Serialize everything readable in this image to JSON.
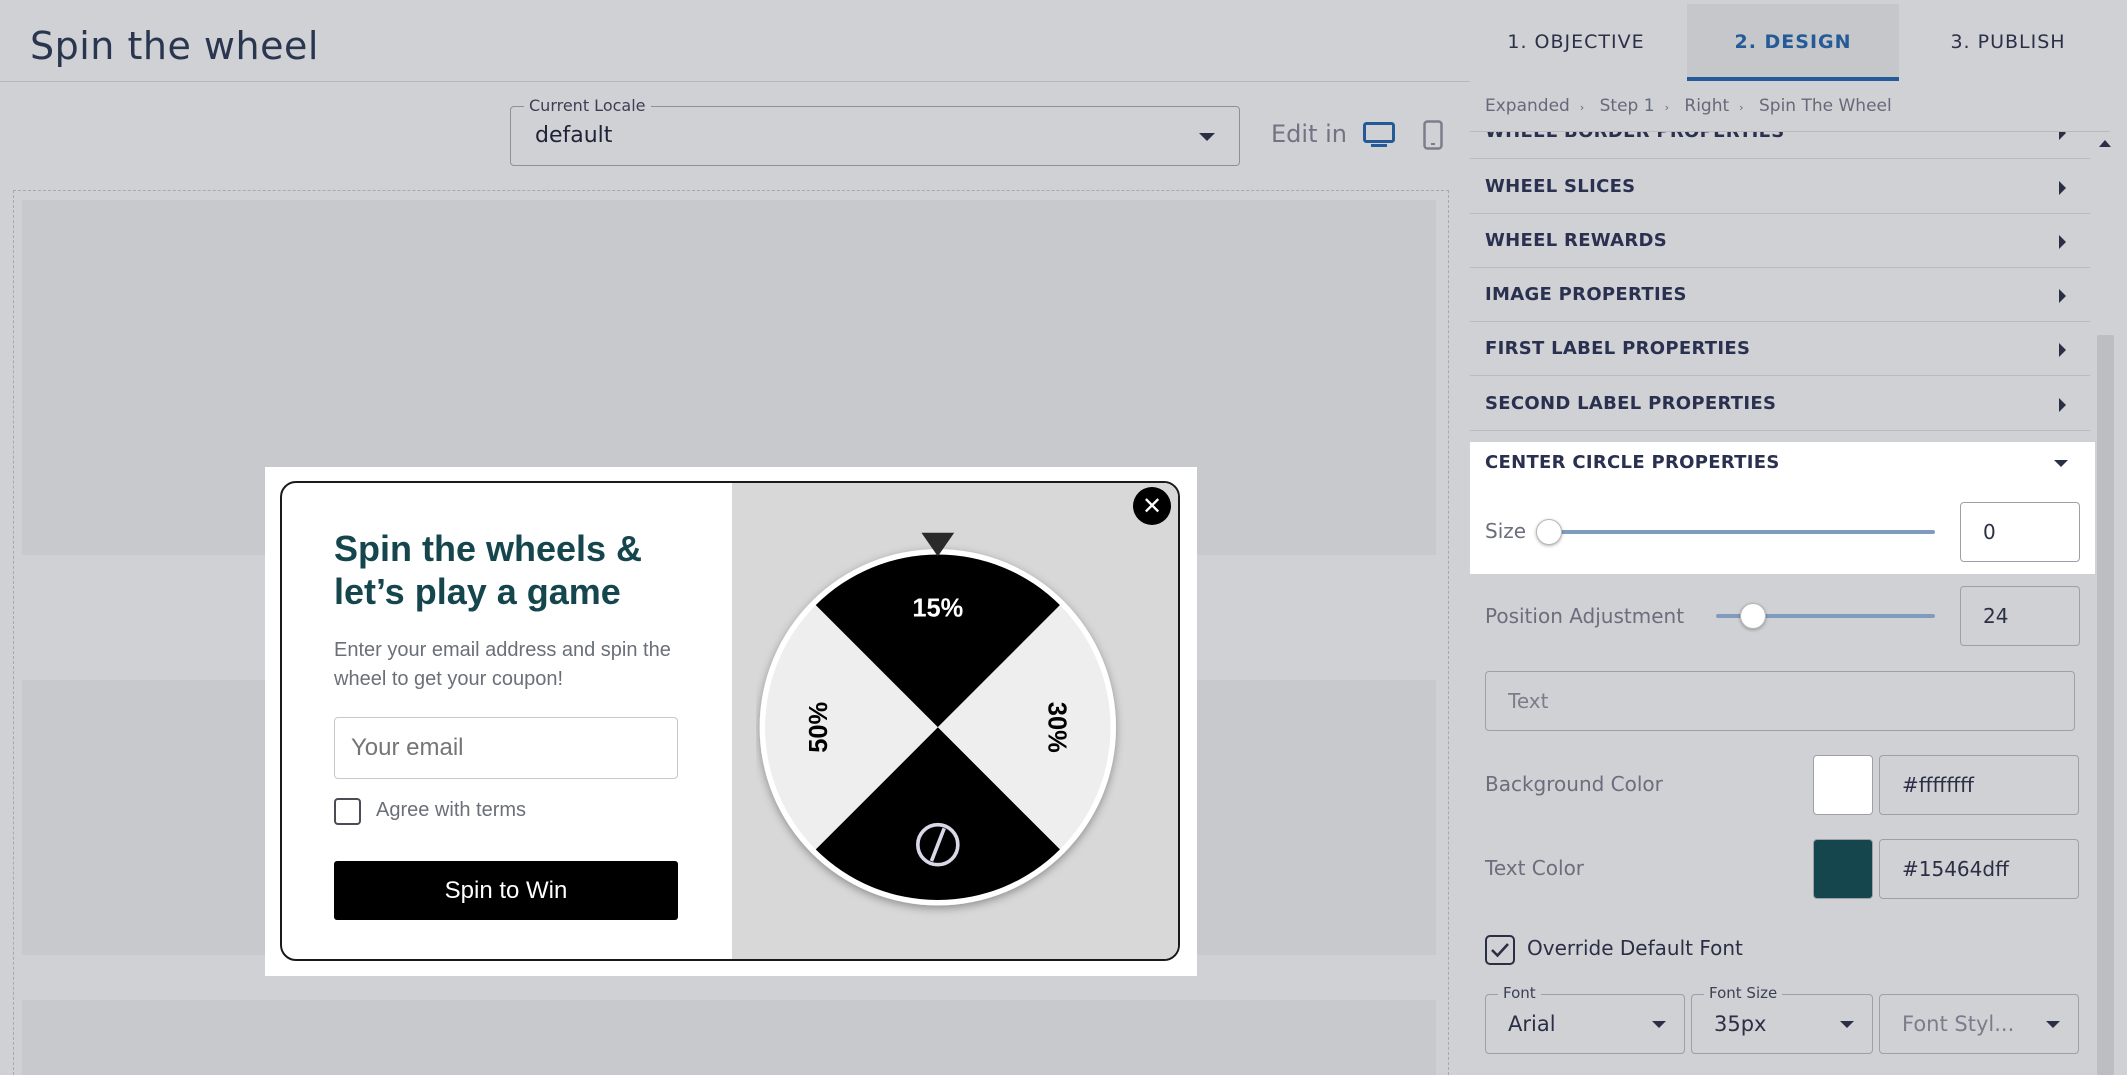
{
  "header": {
    "title": "Spin the wheel"
  },
  "locale": {
    "legend": "Current Locale",
    "value": "default"
  },
  "edit_in": {
    "label": "Edit in",
    "desktop_icon": "desktop-monitor-icon",
    "mobile_icon": "mobile-phone-icon"
  },
  "popup": {
    "headline": "Spin the wheels & let’s play a game",
    "description": "Enter your email address and spin the wheel to get your coupon!",
    "email_placeholder": "Your email",
    "terms_label": "Agree with terms",
    "button_label": "Spin to Win",
    "close_symbol": "✕",
    "headline_color": "#15464d",
    "wheel": {
      "slices": [
        {
          "label": "15%",
          "color": "#000000",
          "text_color": "#ffffff"
        },
        {
          "label": "30%",
          "color": "#eeeeee",
          "text_color": "#000000"
        },
        {
          "label": "",
          "color": "#000000",
          "text_color": "#ffffff",
          "icon": "no-symbol-icon"
        },
        {
          "label": "50%",
          "color": "#eeeeee",
          "text_color": "#000000"
        }
      ]
    }
  },
  "tabs": [
    {
      "label": "1. OBJECTIVE"
    },
    {
      "label": "2. DESIGN",
      "active": true
    },
    {
      "label": "3. PUBLISH"
    }
  ],
  "breadcrumb": [
    "Expanded",
    "Step 1",
    "Right",
    "Spin The Wheel"
  ],
  "sections": [
    {
      "label": "WHEEL BORDER PROPERTIES"
    },
    {
      "label": "WHEEL SLICES"
    },
    {
      "label": "WHEEL REWARDS"
    },
    {
      "label": "IMAGE PROPERTIES"
    },
    {
      "label": "FIRST LABEL PROPERTIES"
    },
    {
      "label": "SECOND LABEL PROPERTIES"
    }
  ],
  "center_circle": {
    "label": "CENTER CIRCLE PROPERTIES",
    "size_label": "Size",
    "size_value": "0",
    "position_label": "Position Adjustment",
    "position_value": "24",
    "text_placeholder": "Text",
    "background_color_label": "Background Color",
    "background_color": "#ffffffff",
    "background_swatch": "#ffffff",
    "text_color_label": "Text Color",
    "text_color": "#15464dff",
    "text_swatch": "#15464d",
    "override_label": "Override Default Font",
    "override_checked": true,
    "font_legend": "Font",
    "font_value": "Arial",
    "font_size_legend": "Font Size",
    "font_size_value": "35px",
    "font_style_placeholder": "Font Styl..."
  }
}
